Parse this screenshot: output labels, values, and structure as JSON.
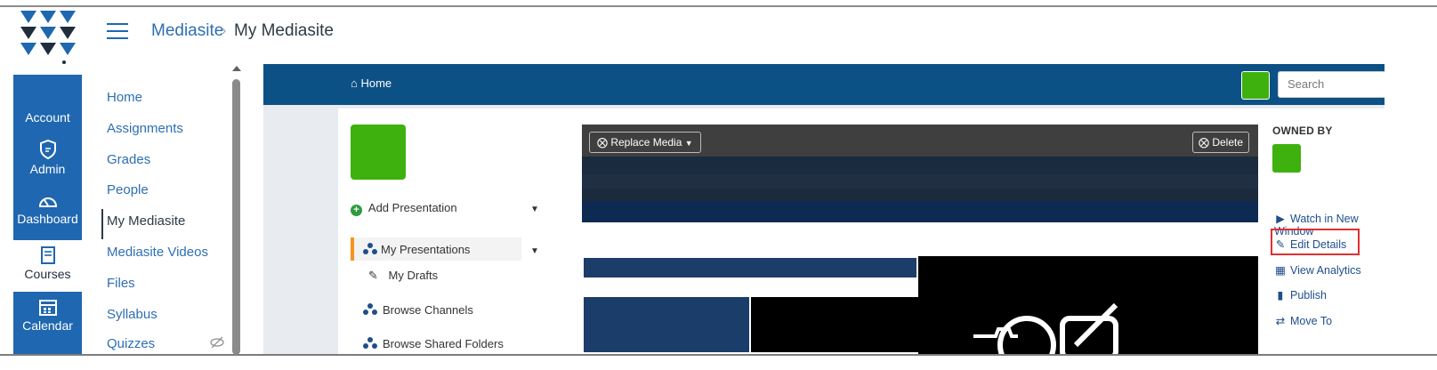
{
  "breadcrumb": {
    "parent": "Mediasite",
    "separator": "›",
    "current": "My Mediasite"
  },
  "rail": {
    "items": [
      {
        "label": "Account",
        "icon": "account-icon"
      },
      {
        "label": "Admin",
        "icon": "shield-icon"
      },
      {
        "label": "Dashboard",
        "icon": "dashboard-icon"
      },
      {
        "label": "Courses",
        "icon": "book-icon"
      },
      {
        "label": "Calendar",
        "icon": "calendar-icon"
      }
    ],
    "accent": "#1f67b0"
  },
  "course_nav": {
    "items": [
      "Home",
      "Assignments",
      "Grades",
      "People",
      "My Mediasite",
      "Mediasite Videos",
      "Files",
      "Syllabus",
      "Quizzes"
    ],
    "active": "My Mediasite"
  },
  "mediasite": {
    "home_label": "Home",
    "search_placeholder": "Search",
    "add_presentation": "Add Presentation",
    "my_presentations": "My Presentations",
    "my_drafts": "My Drafts",
    "browse_channels": "Browse Channels",
    "browse_shared_folders": "Browse Shared Folders",
    "replace_media": "Replace Media",
    "delete": "Delete",
    "owned_by": "OWNED BY",
    "actions": [
      {
        "label": "Watch in New Window",
        "icon": "play-circle-icon"
      },
      {
        "label": "Edit Details",
        "icon": "edit-icon"
      },
      {
        "label": "View Analytics",
        "icon": "analytics-icon"
      },
      {
        "label": "Publish",
        "icon": "book-icon"
      },
      {
        "label": "Move To",
        "icon": "arrows-icon"
      }
    ],
    "colors": {
      "topbar": "#0c5185",
      "avatar": "#3eb10e",
      "highlight": "#e03030"
    }
  }
}
